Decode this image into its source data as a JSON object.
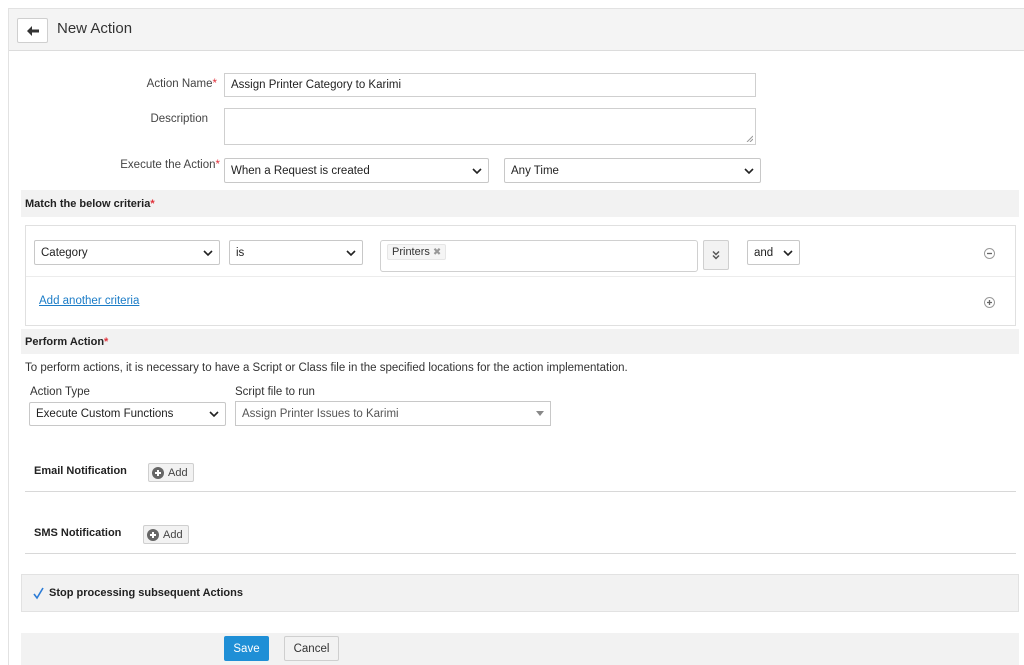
{
  "header": {
    "title": "New Action",
    "back_icon": "arrow-left-icon"
  },
  "form": {
    "action_name": {
      "label": "Action Name",
      "required_mark": "*",
      "value": "Assign Printer Category to Karimi"
    },
    "description": {
      "label": "Description",
      "value": ""
    },
    "execute": {
      "label": "Execute the Action",
      "required_mark": "*",
      "trigger_value": "When a Request is created",
      "time_value": "Any Time"
    }
  },
  "criteria": {
    "heading": "Match the below criteria",
    "required_mark": "*",
    "rows": [
      {
        "field": "Category",
        "operator": "is",
        "values": [
          "Printers"
        ],
        "conjunction": "and"
      }
    ],
    "add_link": "Add another criteria"
  },
  "perform": {
    "heading": "Perform Action ",
    "required_mark": "*",
    "info": "To perform actions, it is necessary to have a Script or Class file in the specified locations for the action implementation.",
    "action_type_label": "Action Type",
    "action_type_value": "Execute Custom Functions",
    "script_label": "Script file to run",
    "script_value": "Assign Printer Issues to Karimi"
  },
  "notifications": {
    "email_label": "Email Notification",
    "sms_label": "SMS Notification",
    "add_label": "Add"
  },
  "stop_processing": {
    "label": "Stop processing subsequent Actions",
    "checked": true
  },
  "footer": {
    "save_label": "Save",
    "cancel_label": "Cancel"
  },
  "colors": {
    "accent": "#1f8fd6",
    "required": "#e0313b",
    "link": "#1b7cc7"
  }
}
